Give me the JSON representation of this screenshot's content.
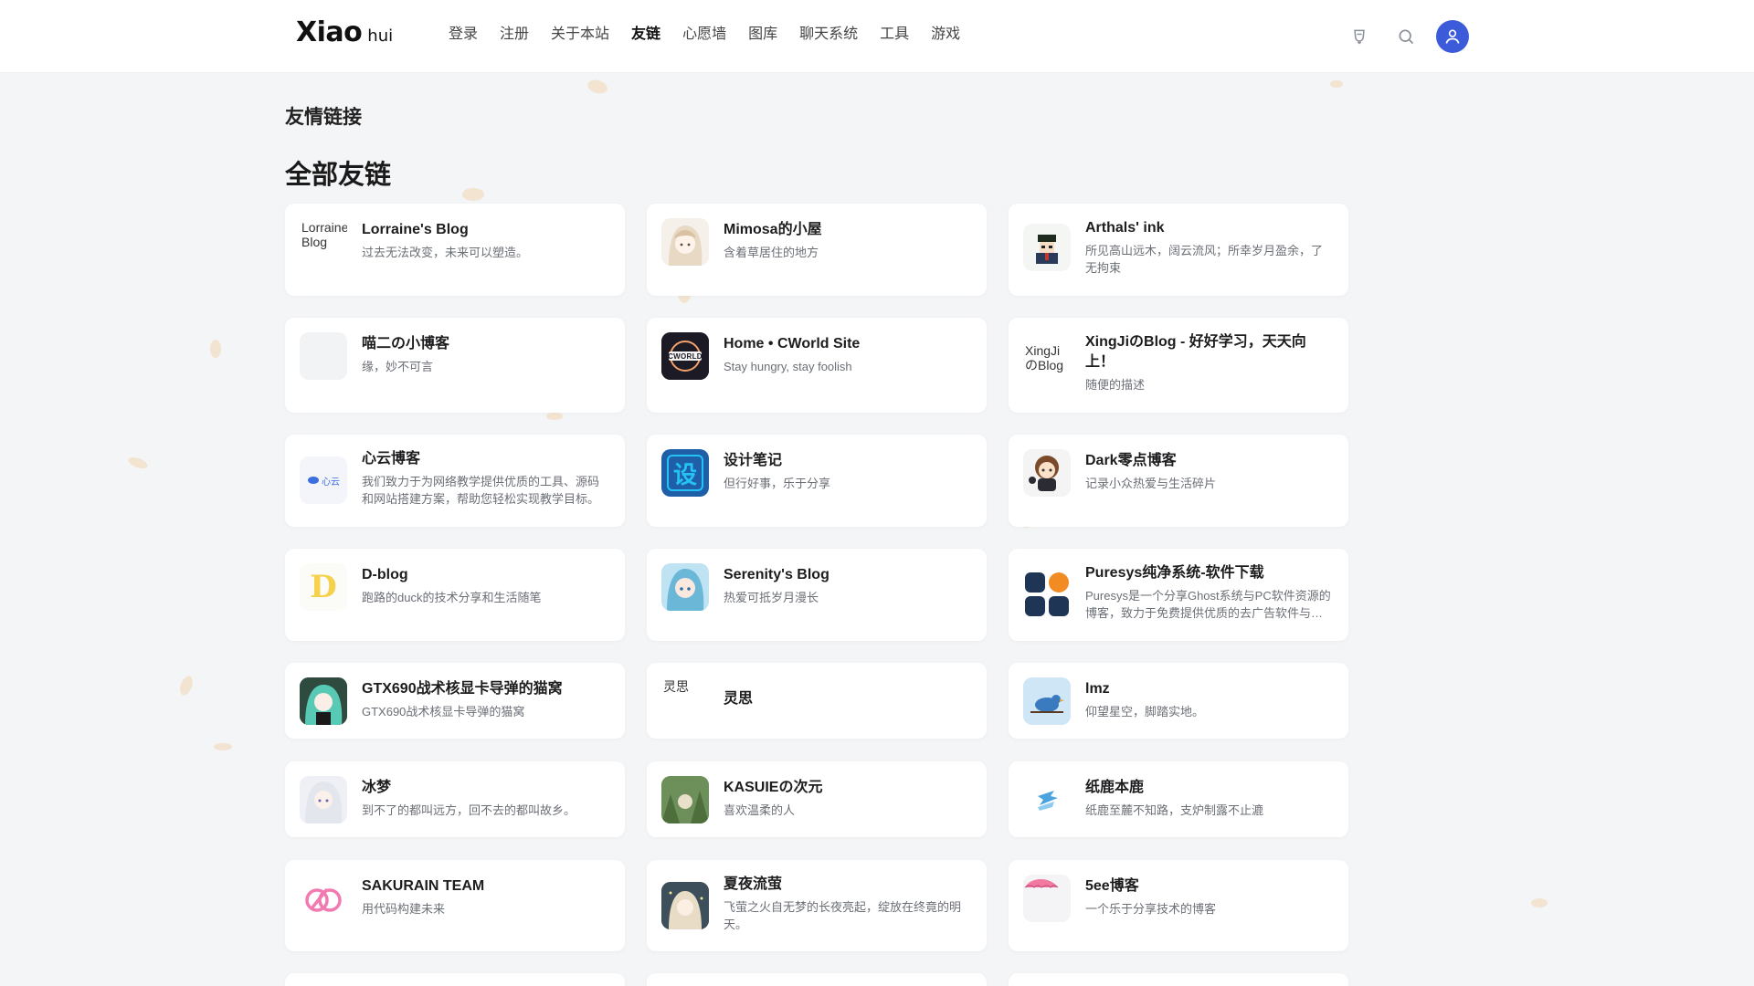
{
  "header": {
    "logo_main": "Xiao",
    "logo_sub": "hui",
    "nav": [
      "登录",
      "注册",
      "关于本站",
      "友链",
      "心愿墙",
      "图库",
      "聊天系统",
      "工具",
      "游戏"
    ],
    "active_nav": "友链",
    "accent_color": "#3b5bdb"
  },
  "page": {
    "crumb": "友情链接",
    "section_title": "全部友链"
  },
  "links": [
    {
      "name": "Lorraine's Blog",
      "desc": "过去无法改变，未来可以塑造。",
      "avatar": "broken-image",
      "alt": "Lorraine Blog"
    },
    {
      "name": "Mimosa的小屋",
      "desc": "含着草居住的地方",
      "avatar": "anime-girl-sketch"
    },
    {
      "name": "Arthals' ink",
      "desc": "所见高山远木，阔云流风；所幸岁月盈余，了无拘束",
      "avatar": "pixel-character"
    },
    {
      "name": "喵二の小博客",
      "desc": "缘，妙不可言",
      "avatar": "blank"
    },
    {
      "name": "Home • CWorld Site",
      "desc": "Stay hungry, stay foolish",
      "avatar": "cworld-logo",
      "logo_text": "CWORLD"
    },
    {
      "name": "XingJiのBlog - 好好学习，天天向上！",
      "desc": "随便的描述",
      "avatar": "broken-image",
      "alt": "XingJiのBlog"
    },
    {
      "name": "心云博客",
      "desc": "我们致力于为网络教学提供优质的工具、源码和网站搭建方案，帮助您轻松实现教学目标。",
      "avatar": "xinyun-logo",
      "logo_text": "心云"
    },
    {
      "name": "设计笔记",
      "desc": "但行好事，乐于分享",
      "avatar": "design-logo",
      "logo_text": "设"
    },
    {
      "name": "Dark零点博客",
      "desc": "记录小众热爱与生活碎片",
      "avatar": "chibi-character"
    },
    {
      "name": "D-blog",
      "desc": "跑路的duck的技术分享和生活随笔",
      "avatar": "d-logo",
      "logo_text": "D"
    },
    {
      "name": "Serenity's Blog",
      "desc": "热爱可抵岁月漫长",
      "avatar": "anime-girl-blue"
    },
    {
      "name": "Puresys纯净系统-软件下载",
      "desc": "Puresys是一个分享Ghost系统与PC软件资源的博客，致力于免费提供优质的去广告软件与纯净系统。",
      "avatar": "puresys-logo"
    },
    {
      "name": "GTX690战术核显卡导弹的猫窝",
      "desc": "GTX690战术核显卡导弹的猫窝",
      "avatar": "anime-girl-green"
    },
    {
      "name": "灵思",
      "desc": "",
      "avatar": "broken-image",
      "alt": "灵思"
    },
    {
      "name": "lmz",
      "desc": "仰望星空，脚踏实地。",
      "avatar": "blue-bird"
    },
    {
      "name": "冰梦",
      "desc": "到不了的都叫远方，回不去的都叫故乡。",
      "avatar": "anime-girl-white"
    },
    {
      "name": "KASUIEの次元",
      "desc": "喜欢温柔的人",
      "avatar": "anime-forest"
    },
    {
      "name": "纸鹿本鹿",
      "desc": "纸鹿至麓不知路，支炉制露不止漉",
      "avatar": "paper-deer-logo"
    },
    {
      "name": "SAKURAIN TEAM",
      "desc": "用代码构建未来",
      "avatar": "sakurain-logo"
    },
    {
      "name": "夏夜流萤",
      "desc": "飞萤之火自无梦的长夜亮起，绽放在终竟的明天。",
      "avatar": "anime-night"
    },
    {
      "name": "5ee博客",
      "desc": "一个乐于分享技术的博客",
      "avatar": "pink-umbrella"
    }
  ]
}
